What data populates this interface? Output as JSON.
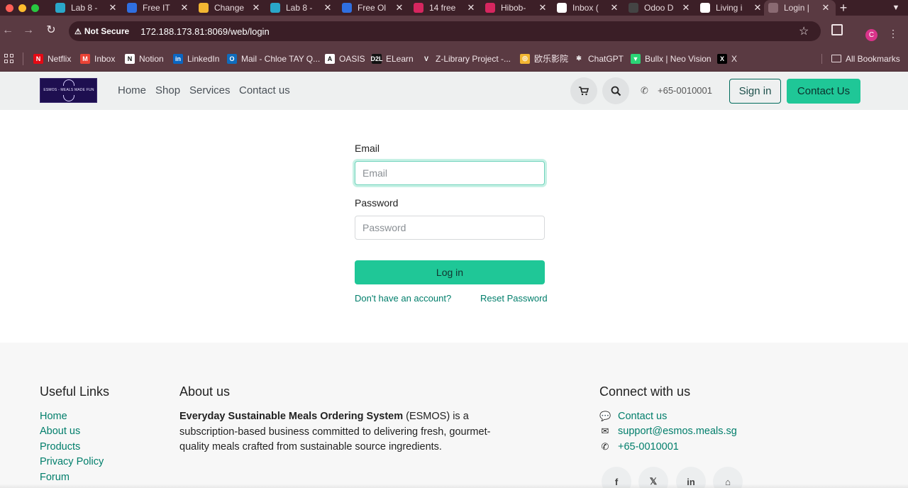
{
  "browser": {
    "tabs": [
      {
        "title": "Lab 8 -",
        "icon": "sap-icon",
        "color": "#2aa7c9"
      },
      {
        "title": "Free IT",
        "icon": "atlassian-icon",
        "color": "#2f6fe0"
      },
      {
        "title": "Change",
        "icon": "document-icon",
        "color": "#f2b632"
      },
      {
        "title": "Lab 8 -",
        "icon": "sap-icon",
        "color": "#2aa7c9"
      },
      {
        "title": "Free Ol",
        "icon": "atlassian-icon",
        "color": "#2f6fe0"
      },
      {
        "title": "14 free",
        "icon": "hibob-icon",
        "color": "#d6265f"
      },
      {
        "title": "Hibob-",
        "icon": "hibob-icon",
        "color": "#d6265f"
      },
      {
        "title": "Inbox (",
        "icon": "gmail-icon",
        "color": "#ffffff"
      },
      {
        "title": "Odoo D",
        "icon": "openai-icon",
        "color": "#444444"
      },
      {
        "title": "Living i",
        "icon": "feather-icon",
        "color": "#ffffff"
      },
      {
        "title": "Login |",
        "icon": "odoo-icon",
        "color": "#8a6a72",
        "active": true
      }
    ],
    "address": {
      "security_label": "Not Secure",
      "url": "172.188.173.81:8069/web/login"
    },
    "profile_initial": "C",
    "bookmarks": [
      {
        "label": "Netflix",
        "icon": "netflix-icon",
        "color": "#e50914",
        "glyph": "N"
      },
      {
        "label": "Inbox",
        "icon": "gmail-icon",
        "color": "#ea4335",
        "glyph": "M"
      },
      {
        "label": "Notion",
        "icon": "notion-icon",
        "color": "#ffffff",
        "glyph": "N"
      },
      {
        "label": "LinkedIn",
        "icon": "linkedin-icon",
        "color": "#0a66c2",
        "glyph": "in"
      },
      {
        "label": "Mail - Chloe TAY Q...",
        "icon": "outlook-icon",
        "color": "#0f6cbd",
        "glyph": "O"
      },
      {
        "label": "OASIS",
        "icon": "oasis-icon",
        "color": "#ffffff",
        "glyph": "A"
      },
      {
        "label": "ELearn",
        "icon": "d2l-icon",
        "color": "#111111",
        "glyph": "D2L"
      },
      {
        "label": "Z-Library Project -...",
        "icon": "zlibrary-icon",
        "color": "#5a3a42",
        "glyph": "V"
      },
      {
        "label": "欧乐影院",
        "icon": "movie-icon",
        "color": "#f2b632",
        "glyph": "◎"
      },
      {
        "label": "ChatGPT",
        "icon": "openai-icon",
        "color": "#5a3a42",
        "glyph": "✻"
      },
      {
        "label": "Bullx | Neo Vision",
        "icon": "bullx-icon",
        "color": "#2bd576",
        "glyph": "▼"
      },
      {
        "label": "X",
        "icon": "x-icon",
        "color": "#000000",
        "glyph": "X"
      }
    ],
    "all_bookmarks_label": "All Bookmarks"
  },
  "site": {
    "logo_text": "ESMOS - MEALS MADE FUN",
    "nav": [
      "Home",
      "Shop",
      "Services",
      "Contact us"
    ],
    "phone": "+65-0010001",
    "sign_in_label": "Sign in",
    "contact_button_label": "Contact Us"
  },
  "login": {
    "email_label": "Email",
    "email_placeholder": "Email",
    "password_label": "Password",
    "password_placeholder": "Password",
    "submit_label": "Log in",
    "signup_link": "Don't have an account?",
    "reset_link": "Reset Password"
  },
  "footer": {
    "useful_links_title": "Useful Links",
    "useful_links": [
      "Home",
      "About us",
      "Products",
      "Privacy Policy",
      "Forum"
    ],
    "about_title": "About us",
    "about_bold": "Everyday Sustainable Meals Ordering System",
    "about_rest": " (ESMOS) is a subscription-based business committed to delivering fresh, gourmet-quality meals crafted from sustainable source ingredients.",
    "connect_title": "Connect with us",
    "connect_items": [
      {
        "icon": "chat-icon",
        "text": "Contact us"
      },
      {
        "icon": "envelope-icon",
        "text": "support@esmos.meals.sg"
      },
      {
        "icon": "phone-icon",
        "text": "+65-0010001"
      }
    ],
    "social": [
      {
        "icon": "facebook-icon",
        "glyph": "f"
      },
      {
        "icon": "x-twitter-icon",
        "glyph": "𝕏"
      },
      {
        "icon": "linkedin-icon",
        "glyph": "in"
      },
      {
        "icon": "home-icon",
        "glyph": "⌂"
      }
    ]
  },
  "colors": {
    "accent": "#1fc797",
    "link": "#017e6b",
    "chrome": "#5a3a42"
  }
}
